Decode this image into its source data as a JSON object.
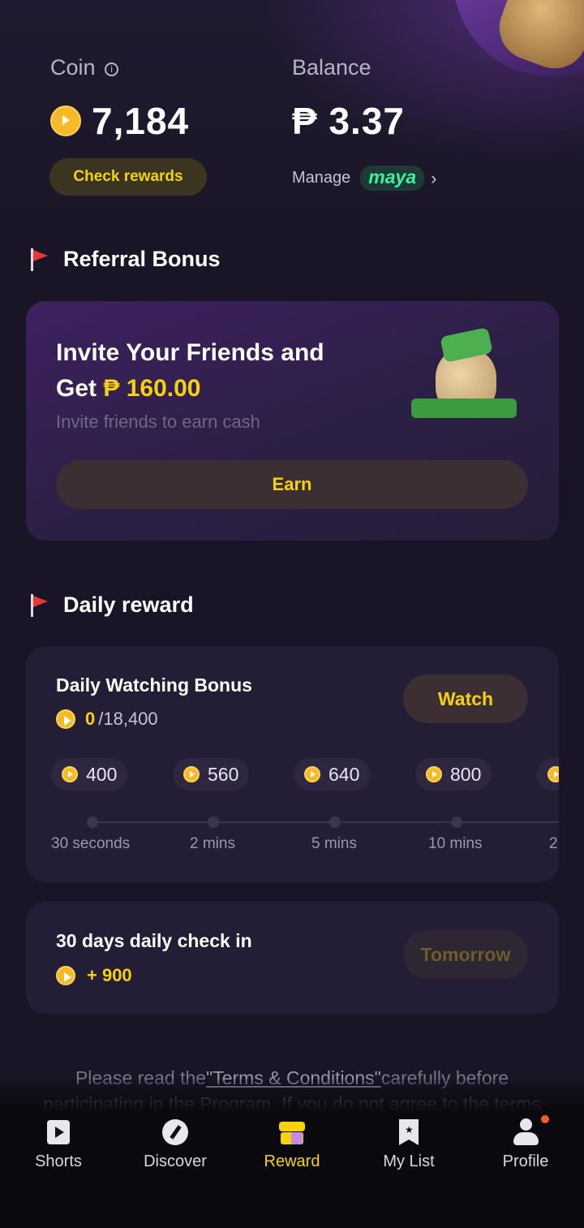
{
  "coin": {
    "label": "Coin",
    "value": "7,184",
    "check_rewards": "Check rewards"
  },
  "balance": {
    "label": "Balance",
    "value": "₱ 3.37",
    "manage": "Manage",
    "wallet_logo": "maya"
  },
  "referral": {
    "section_title": "Referral Bonus",
    "headline_line1": "Invite Your Friends and",
    "headline_line2_prefix": "Get ",
    "headline_amount": "₱ 160.00",
    "subtitle": "Invite friends to earn cash",
    "button": "Earn"
  },
  "daily": {
    "section_title": "Daily reward",
    "watching": {
      "title": "Daily Watching Bonus",
      "progress_current": "0",
      "progress_total": "/18,400",
      "button": "Watch",
      "milestones": [
        {
          "coins": "400",
          "time": "30 seconds"
        },
        {
          "coins": "560",
          "time": "2 mins"
        },
        {
          "coins": "640",
          "time": "5 mins"
        },
        {
          "coins": "800",
          "time": "10 mins"
        },
        {
          "coins": "",
          "time": "2"
        }
      ]
    },
    "checkin": {
      "title": "30 days daily check in",
      "reward": "+ 900",
      "button": "Tomorrow"
    }
  },
  "terms": {
    "prefix": "Please read the",
    "link": "\"Terms & Conditions\"",
    "suffix": "carefully before participating in the Program. If you do not agree to the terms"
  },
  "nav": {
    "items": [
      {
        "label": "Shorts",
        "icon": "play-square-icon"
      },
      {
        "label": "Discover",
        "icon": "compass-icon"
      },
      {
        "label": "Reward",
        "icon": "gift-icon"
      },
      {
        "label": "My List",
        "icon": "bookmark-icon"
      },
      {
        "label": "Profile",
        "icon": "person-icon"
      }
    ],
    "active": "Reward"
  },
  "colors": {
    "accent": "#f5d20c",
    "background": "#1a1526",
    "card": "#241d36",
    "maya": "#3df0a0"
  }
}
